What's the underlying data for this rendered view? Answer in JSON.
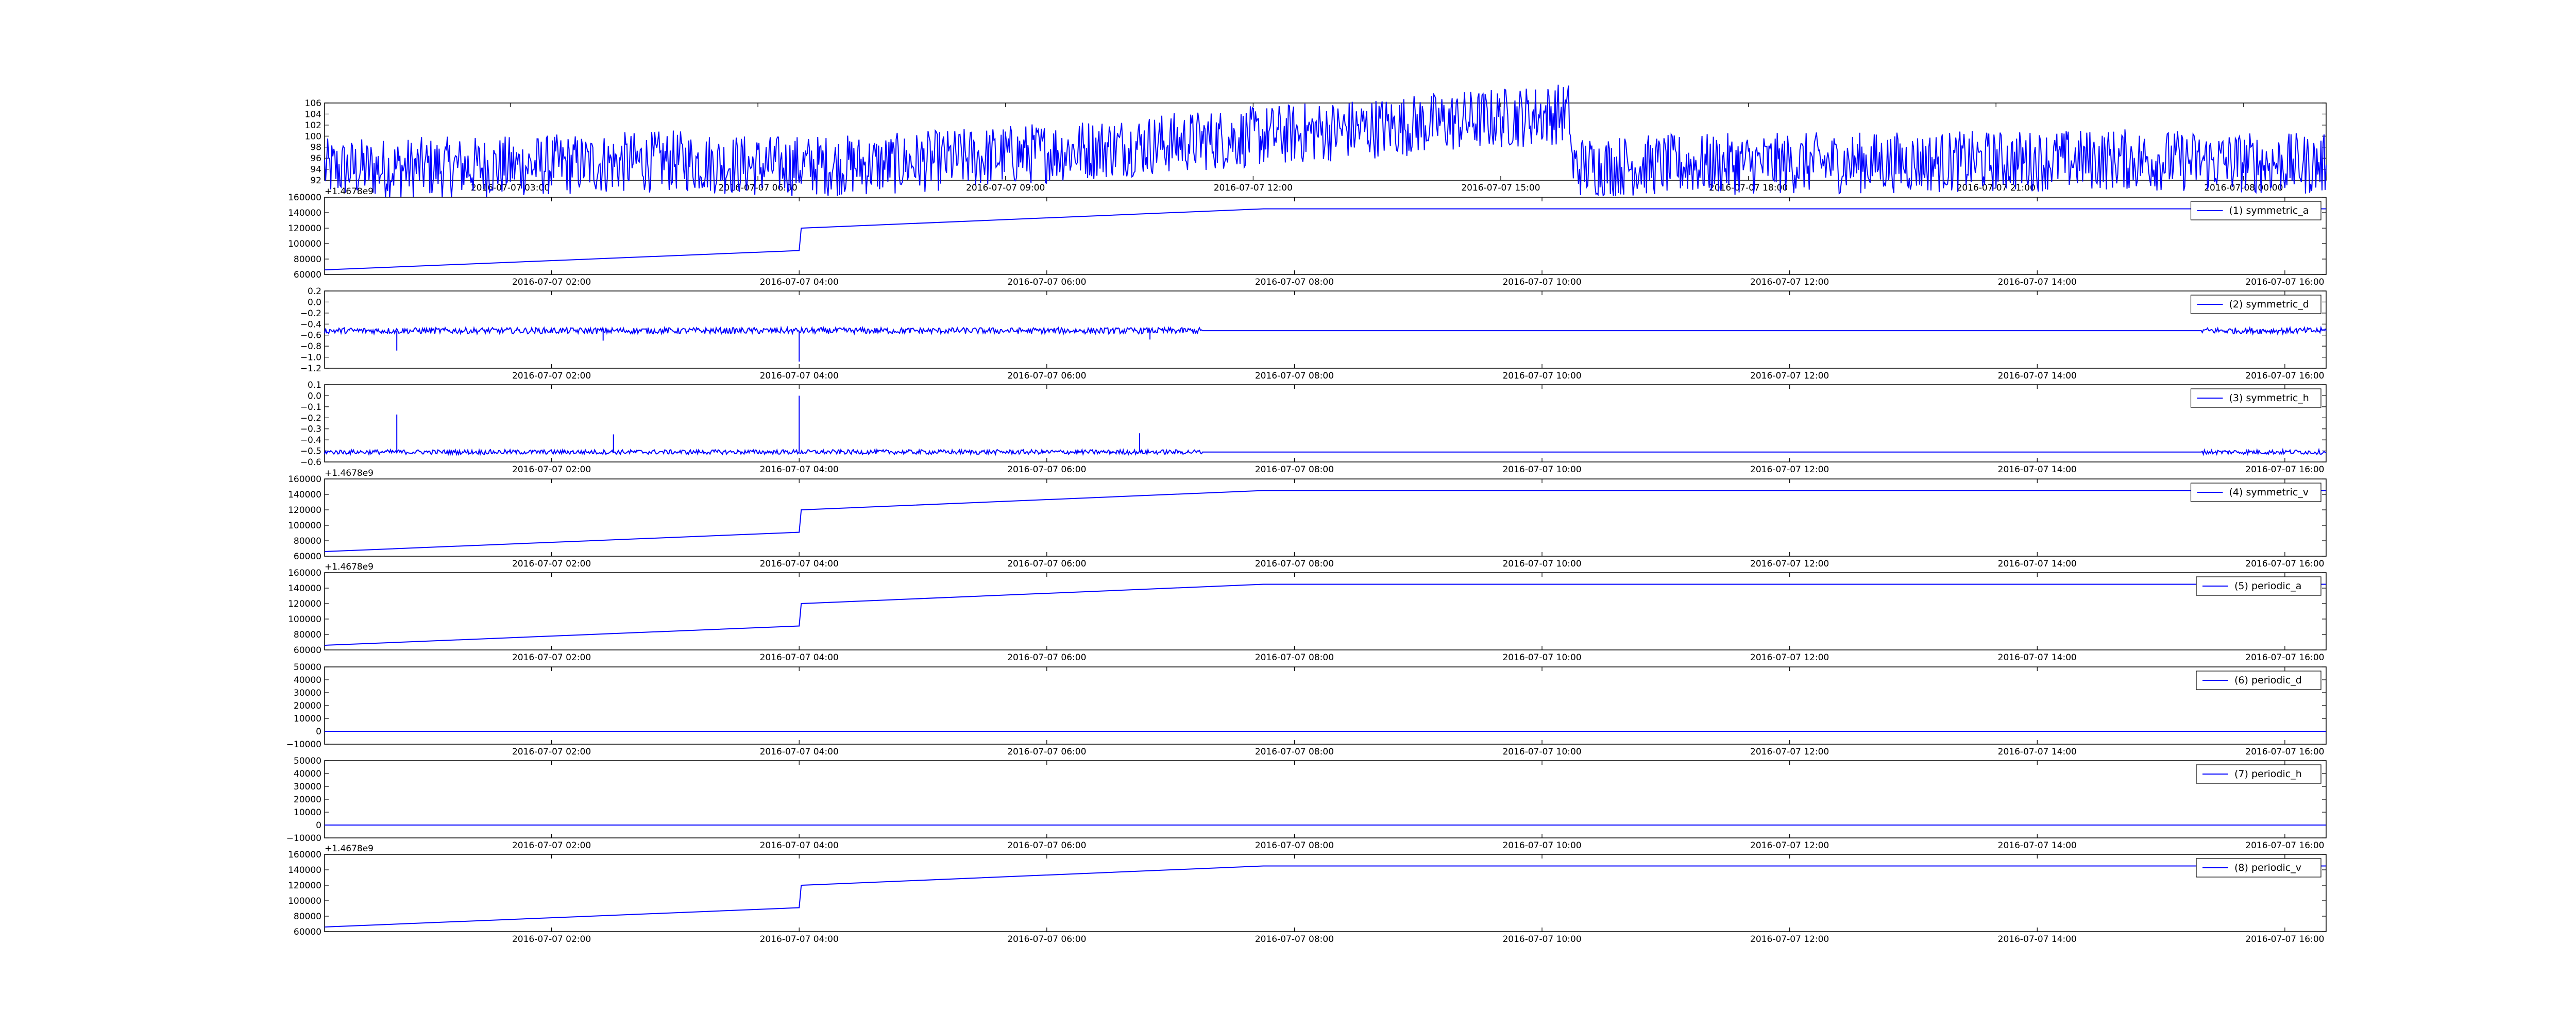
{
  "line_color": "#0000ff",
  "chart_data": [
    {
      "type": "line",
      "offset_label": "",
      "yticks": [
        "106",
        "104",
        "102",
        "100",
        "98",
        "96",
        "94",
        "92"
      ],
      "ylim": [
        92,
        106
      ],
      "xlim": [
        "2016-07-07 00:45",
        "2016-07-08 01:00"
      ],
      "xticks": [
        "2016-07-07 03:00",
        "2016-07-07 06:00",
        "2016-07-07 09:00",
        "2016-07-07 12:00",
        "2016-07-07 15:00",
        "2016-07-07 18:00",
        "2016-07-07 21:00",
        "2016-07-08 00:00"
      ],
      "legend": "",
      "series": [
        {
          "x": [
            "2016-07-07 00:45",
            "2016-07-07 03:00",
            "2016-07-07 05:00",
            "2016-07-07 06:00",
            "2016-07-07 07:30",
            "2016-07-07 15:50",
            "2016-07-07 15:52",
            "2016-07-07 18:00",
            "2016-07-07 21:00",
            "2016-07-07 22:30",
            "2016-07-08 01:00"
          ],
          "y": [
            94.0,
            94.5,
            95.5,
            94.6,
            94.8,
            104.2,
            94.5,
            95.0,
            95.4,
            95.8,
            94.8
          ],
          "noise": 0.4
        }
      ]
    },
    {
      "type": "line",
      "offset_label": "+1.4678e9",
      "yticks": [
        "160000",
        "140000",
        "120000",
        "100000",
        "80000",
        "60000"
      ],
      "ylim": [
        60000,
        160000
      ],
      "xlim": [
        "2016-07-07 00:10",
        "2016-07-07 16:20"
      ],
      "xticks": [
        "2016-07-07 02:00",
        "2016-07-07 04:00",
        "2016-07-07 06:00",
        "2016-07-07 08:00",
        "2016-07-07 10:00",
        "2016-07-07 12:00",
        "2016-07-07 14:00",
        "2016-07-07 16:00"
      ],
      "legend": "(1) symmetric_a",
      "series": [
        {
          "x": [
            "2016-07-07 00:10",
            "2016-07-07 04:00",
            "2016-07-07 04:01",
            "2016-07-07 07:45",
            "2016-07-07 16:20"
          ],
          "y": [
            66000,
            91000,
            120000,
            145000,
            145000
          ],
          "noise": 0
        }
      ]
    },
    {
      "type": "line",
      "offset_label": "",
      "yticks": [
        "0.2",
        "0.0",
        "−0.2",
        "−0.4",
        "−0.6",
        "−0.8",
        "−1.0",
        "−1.2"
      ],
      "ylim": [
        -1.2,
        0.2
      ],
      "xlim": [
        "2016-07-07 00:10",
        "2016-07-07 16:20"
      ],
      "xticks": [
        "2016-07-07 02:00",
        "2016-07-07 04:00",
        "2016-07-07 06:00",
        "2016-07-07 08:00",
        "2016-07-07 10:00",
        "2016-07-07 12:00",
        "2016-07-07 14:00",
        "2016-07-07 16:00"
      ],
      "legend": "(2) symmetric_d",
      "series": [
        {
          "x": [
            "2016-07-07 00:10",
            "2016-07-07 07:15",
            "2016-07-07 15:20",
            "2016-07-07 16:20"
          ],
          "y": [
            -0.52,
            -0.52,
            -0.52,
            -0.52
          ],
          "noise": 0.04,
          "noise_until": "2016-07-07 07:15",
          "noise_after": "2016-07-07 15:20",
          "spikes": [
            [
              "2016-07-07 00:45",
              -0.88
            ],
            [
              "2016-07-07 04:00",
              -1.08
            ],
            [
              "2016-07-07 02:25",
              -0.7
            ],
            [
              "2016-07-07 06:50",
              -0.68
            ]
          ]
        }
      ]
    },
    {
      "type": "line",
      "offset_label": "",
      "yticks": [
        "0.1",
        "0.0",
        "−0.1",
        "−0.2",
        "−0.3",
        "−0.4",
        "−0.5",
        "−0.6"
      ],
      "ylim": [
        -0.6,
        0.1
      ],
      "xlim": [
        "2016-07-07 00:10",
        "2016-07-07 16:20"
      ],
      "xticks": [
        "2016-07-07 02:00",
        "2016-07-07 04:00",
        "2016-07-07 06:00",
        "2016-07-07 08:00",
        "2016-07-07 10:00",
        "2016-07-07 12:00",
        "2016-07-07 14:00",
        "2016-07-07 16:00"
      ],
      "legend": "(3) symmetric_h",
      "series": [
        {
          "x": [
            "2016-07-07 00:10",
            "2016-07-07 07:15",
            "2016-07-07 15:20",
            "2016-07-07 16:20"
          ],
          "y": [
            -0.51,
            -0.51,
            -0.51,
            -0.51
          ],
          "noise": 0.03,
          "noise_until": "2016-07-07 07:15",
          "noise_after": "2016-07-07 15:20",
          "spikes": [
            [
              "2016-07-07 00:45",
              -0.17
            ],
            [
              "2016-07-07 04:00",
              0.0
            ],
            [
              "2016-07-07 02:30",
              -0.35
            ],
            [
              "2016-07-07 06:45",
              -0.34
            ]
          ]
        }
      ]
    },
    {
      "type": "line",
      "offset_label": "+1.4678e9",
      "yticks": [
        "160000",
        "140000",
        "120000",
        "100000",
        "80000",
        "60000"
      ],
      "ylim": [
        60000,
        160000
      ],
      "xlim": [
        "2016-07-07 00:10",
        "2016-07-07 16:20"
      ],
      "xticks": [
        "2016-07-07 02:00",
        "2016-07-07 04:00",
        "2016-07-07 06:00",
        "2016-07-07 08:00",
        "2016-07-07 10:00",
        "2016-07-07 12:00",
        "2016-07-07 14:00",
        "2016-07-07 16:00"
      ],
      "legend": "(4) symmetric_v",
      "series": [
        {
          "x": [
            "2016-07-07 00:10",
            "2016-07-07 04:00",
            "2016-07-07 04:01",
            "2016-07-07 07:45",
            "2016-07-07 16:20"
          ],
          "y": [
            66000,
            91000,
            120000,
            145000,
            145000
          ],
          "noise": 0
        }
      ]
    },
    {
      "type": "line",
      "offset_label": "+1.4678e9",
      "yticks": [
        "160000",
        "140000",
        "120000",
        "100000",
        "80000",
        "60000"
      ],
      "ylim": [
        60000,
        160000
      ],
      "xlim": [
        "2016-07-07 00:10",
        "2016-07-07 16:20"
      ],
      "xticks": [
        "2016-07-07 02:00",
        "2016-07-07 04:00",
        "2016-07-07 06:00",
        "2016-07-07 08:00",
        "2016-07-07 10:00",
        "2016-07-07 12:00",
        "2016-07-07 14:00",
        "2016-07-07 16:00"
      ],
      "legend": "(5) periodic_a",
      "series": [
        {
          "x": [
            "2016-07-07 00:10",
            "2016-07-07 04:00",
            "2016-07-07 04:01",
            "2016-07-07 07:45",
            "2016-07-07 16:20"
          ],
          "y": [
            66000,
            91000,
            120000,
            145000,
            145000
          ],
          "noise": 0
        }
      ]
    },
    {
      "type": "line",
      "offset_label": "",
      "yticks": [
        "50000",
        "40000",
        "30000",
        "20000",
        "10000",
        "0",
        "−10000"
      ],
      "ylim": [
        -10000,
        50000
      ],
      "xlim": [
        "2016-07-07 00:10",
        "2016-07-07 16:20"
      ],
      "xticks": [
        "2016-07-07 02:00",
        "2016-07-07 04:00",
        "2016-07-07 06:00",
        "2016-07-07 08:00",
        "2016-07-07 10:00",
        "2016-07-07 12:00",
        "2016-07-07 14:00",
        "2016-07-07 16:00"
      ],
      "legend": "(6) periodic_d",
      "series": [
        {
          "x": [
            "2016-07-07 00:10",
            "2016-07-07 16:20"
          ],
          "y": [
            0,
            0
          ],
          "noise": 0
        }
      ]
    },
    {
      "type": "line",
      "offset_label": "",
      "yticks": [
        "50000",
        "40000",
        "30000",
        "20000",
        "10000",
        "0",
        "−10000"
      ],
      "ylim": [
        -10000,
        50000
      ],
      "xlim": [
        "2016-07-07 00:10",
        "2016-07-07 16:20"
      ],
      "xticks": [
        "2016-07-07 02:00",
        "2016-07-07 04:00",
        "2016-07-07 06:00",
        "2016-07-07 08:00",
        "2016-07-07 10:00",
        "2016-07-07 12:00",
        "2016-07-07 14:00",
        "2016-07-07 16:00"
      ],
      "legend": "(7) periodic_h",
      "series": [
        {
          "x": [
            "2016-07-07 00:10",
            "2016-07-07 16:20"
          ],
          "y": [
            0,
            0
          ],
          "noise": 0
        }
      ]
    },
    {
      "type": "line",
      "offset_label": "+1.4678e9",
      "yticks": [
        "160000",
        "140000",
        "120000",
        "100000",
        "80000",
        "60000"
      ],
      "ylim": [
        60000,
        160000
      ],
      "xlim": [
        "2016-07-07 00:10",
        "2016-07-07 16:20"
      ],
      "xticks": [
        "2016-07-07 02:00",
        "2016-07-07 04:00",
        "2016-07-07 06:00",
        "2016-07-07 08:00",
        "2016-07-07 10:00",
        "2016-07-07 12:00",
        "2016-07-07 14:00",
        "2016-07-07 16:00"
      ],
      "legend": "(8) periodic_v",
      "series": [
        {
          "x": [
            "2016-07-07 00:10",
            "2016-07-07 04:00",
            "2016-07-07 04:01",
            "2016-07-07 07:45",
            "2016-07-07 16:20"
          ],
          "y": [
            66000,
            91000,
            120000,
            145000,
            145000
          ],
          "noise": 0
        }
      ]
    }
  ]
}
